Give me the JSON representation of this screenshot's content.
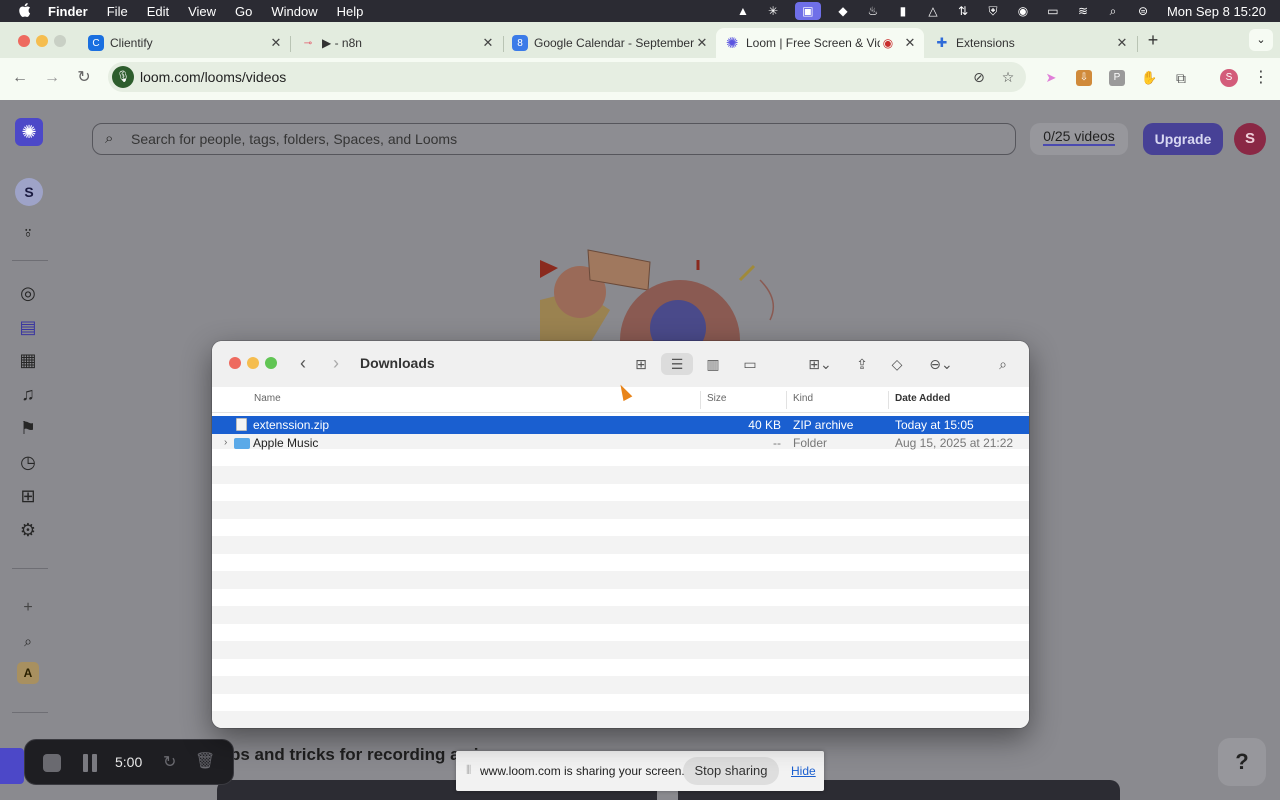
{
  "menubar": {
    "app": "Finder",
    "items": [
      "File",
      "Edit",
      "View",
      "Go",
      "Window",
      "Help"
    ],
    "clock": "Mon Sep 8  15:20"
  },
  "browser": {
    "tabs": [
      {
        "title": "Clientify",
        "icon": "clientify-icon"
      },
      {
        "title": "▶ - n8n",
        "icon": "n8n-icon"
      },
      {
        "title": "Google Calendar - September",
        "icon": "google-calendar-icon"
      },
      {
        "title": "Loom | Free Screen & Video",
        "icon": "loom-icon"
      },
      {
        "title": "Extensions",
        "icon": "puzzle-icon"
      }
    ],
    "url": "loom.com/looms/videos"
  },
  "loom": {
    "search_placeholder": "Search for people, tags, folders, Spaces, and Looms",
    "video_count": "0/25 videos",
    "upgrade_label": "Upgrade",
    "workspace_initial": "S",
    "user_initial": "S",
    "space_initial": "A",
    "tips_heading": "ps and tricks for recording a vi",
    "help_label": "?"
  },
  "recorder": {
    "timer": "5:00"
  },
  "share_notice": {
    "message": "www.loom.com is sharing your screen.",
    "stop_label": "Stop sharing",
    "hide_label": "Hide"
  },
  "finder": {
    "title": "Downloads",
    "columns": {
      "name": "Name",
      "size": "Size",
      "kind": "Kind",
      "date": "Date Added"
    },
    "rows": [
      {
        "name": "extenssion.zip",
        "size": "40 KB",
        "kind": "ZIP archive",
        "date": "Today at 15:05",
        "selected": true
      },
      {
        "name": "Apple Music",
        "size": "--",
        "kind": "Folder",
        "date": "Aug 15, 2025 at 21:22",
        "selected": false
      }
    ]
  },
  "colors": {
    "selection": "#1a5fd0",
    "loom_brand": "#4c48c8",
    "upgrade_button": "#474196"
  }
}
